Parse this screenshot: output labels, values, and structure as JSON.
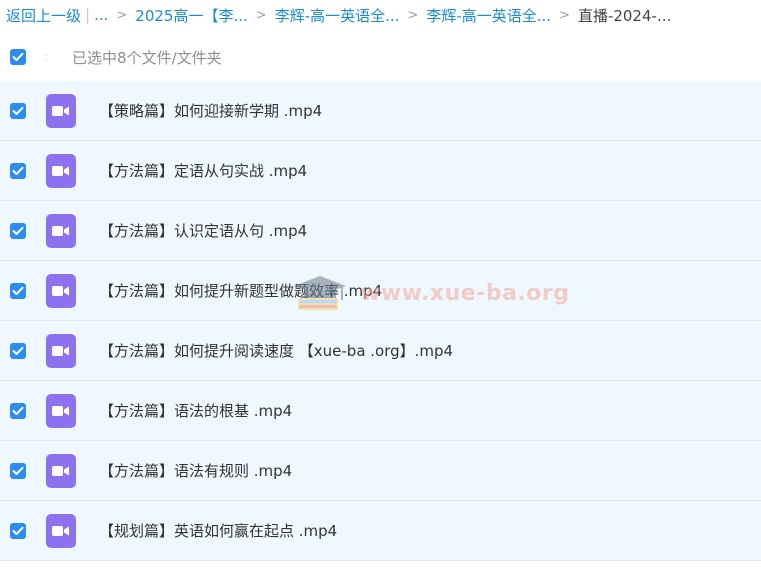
{
  "breadcrumb": {
    "back_label": "返回上一级",
    "ellipsis": "...",
    "items": [
      "2025高一【李...",
      "李辉-高一英语全...",
      "李辉-高一英语全..."
    ],
    "current": "直播-2024-..."
  },
  "selection": {
    "summary": "已选中8个文件/文件夹"
  },
  "files": [
    {
      "name": "【策略篇】如何迎接新学期 .mp4"
    },
    {
      "name": "【方法篇】定语从句实战 .mp4"
    },
    {
      "name": "【方法篇】认识定语从句 .mp4"
    },
    {
      "name": "【方法篇】如何提升新题型做题效率 .mp4"
    },
    {
      "name": "【方法篇】如何提升阅读速度 【xue-ba .org】.mp4"
    },
    {
      "name": "【方法篇】语法的根基 .mp4"
    },
    {
      "name": "【方法篇】语法有规则 .mp4"
    },
    {
      "name": "【规划篇】英语如何赢在起点 .mp4"
    }
  ],
  "watermark": {
    "text": "www.xue-ba.org"
  },
  "colors": {
    "link": "#1a8cd8",
    "checkbox": "#2d8cf0",
    "video_icon": "#8d72f0",
    "row_bg": "#f0f8ff"
  }
}
